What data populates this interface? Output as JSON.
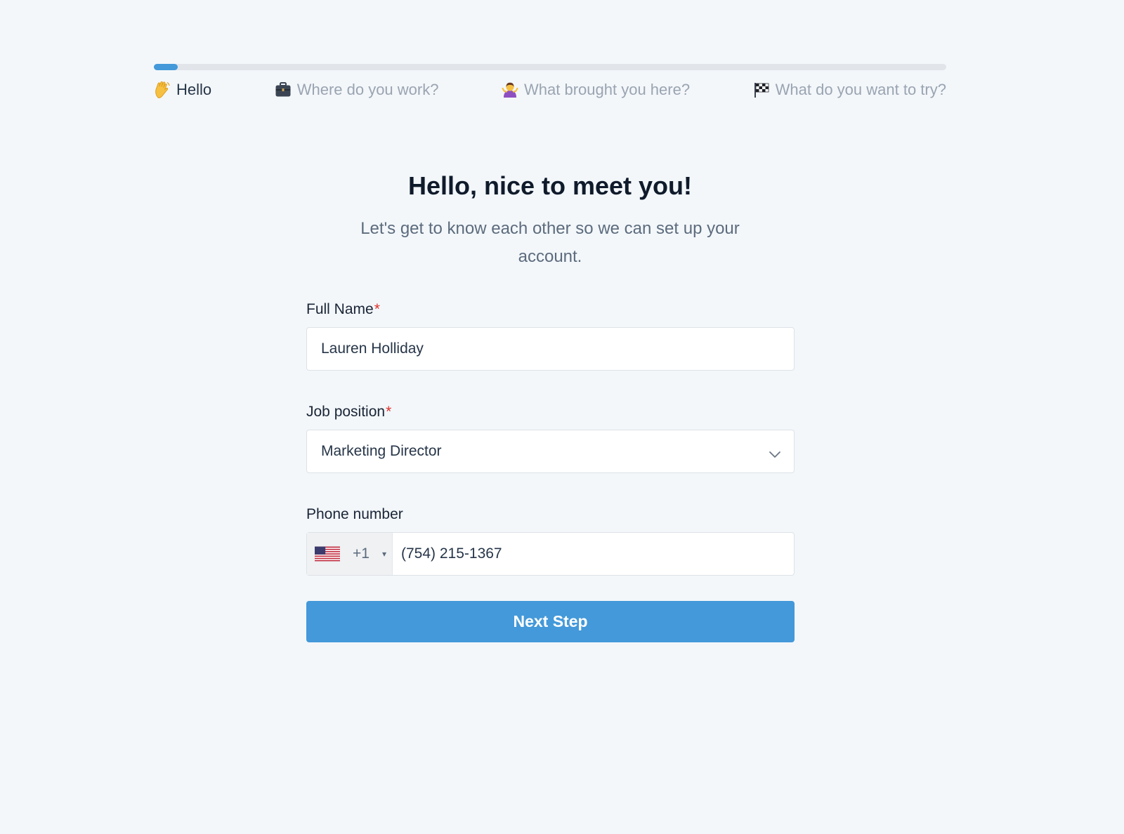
{
  "colors": {
    "accent": "#4399d9",
    "background": "#f3f7fa",
    "required": "#e0332e",
    "inactive_step": "#9aa4b1",
    "active_step": "#263548"
  },
  "progress": {
    "fraction": 0.03
  },
  "steps": [
    {
      "label": "Hello",
      "icon": "waving-hand-icon",
      "active": true
    },
    {
      "label": "Where do you work?",
      "icon": "briefcase-icon",
      "active": false
    },
    {
      "label": "What brought you here?",
      "icon": "person-shrugging-icon",
      "active": false
    },
    {
      "label": "What do you want to try?",
      "icon": "checkered-flag-icon",
      "active": false
    }
  ],
  "header": {
    "title": "Hello, nice to meet you!",
    "subtitle": "Let's get to know each other so we can set up your account."
  },
  "form": {
    "full_name": {
      "label": "Full Name",
      "required_mark": "*",
      "value": "Lauren Holliday"
    },
    "job_position": {
      "label": "Job position",
      "required_mark": "*",
      "selected": "Marketing Director",
      "icon": "chevron-down-icon"
    },
    "phone": {
      "label": "Phone number",
      "country_icon": "us-flag-icon",
      "dial_code": "+1",
      "caret": "▾",
      "value": "(754) 215-1367"
    },
    "submit_label": "Next Step"
  }
}
